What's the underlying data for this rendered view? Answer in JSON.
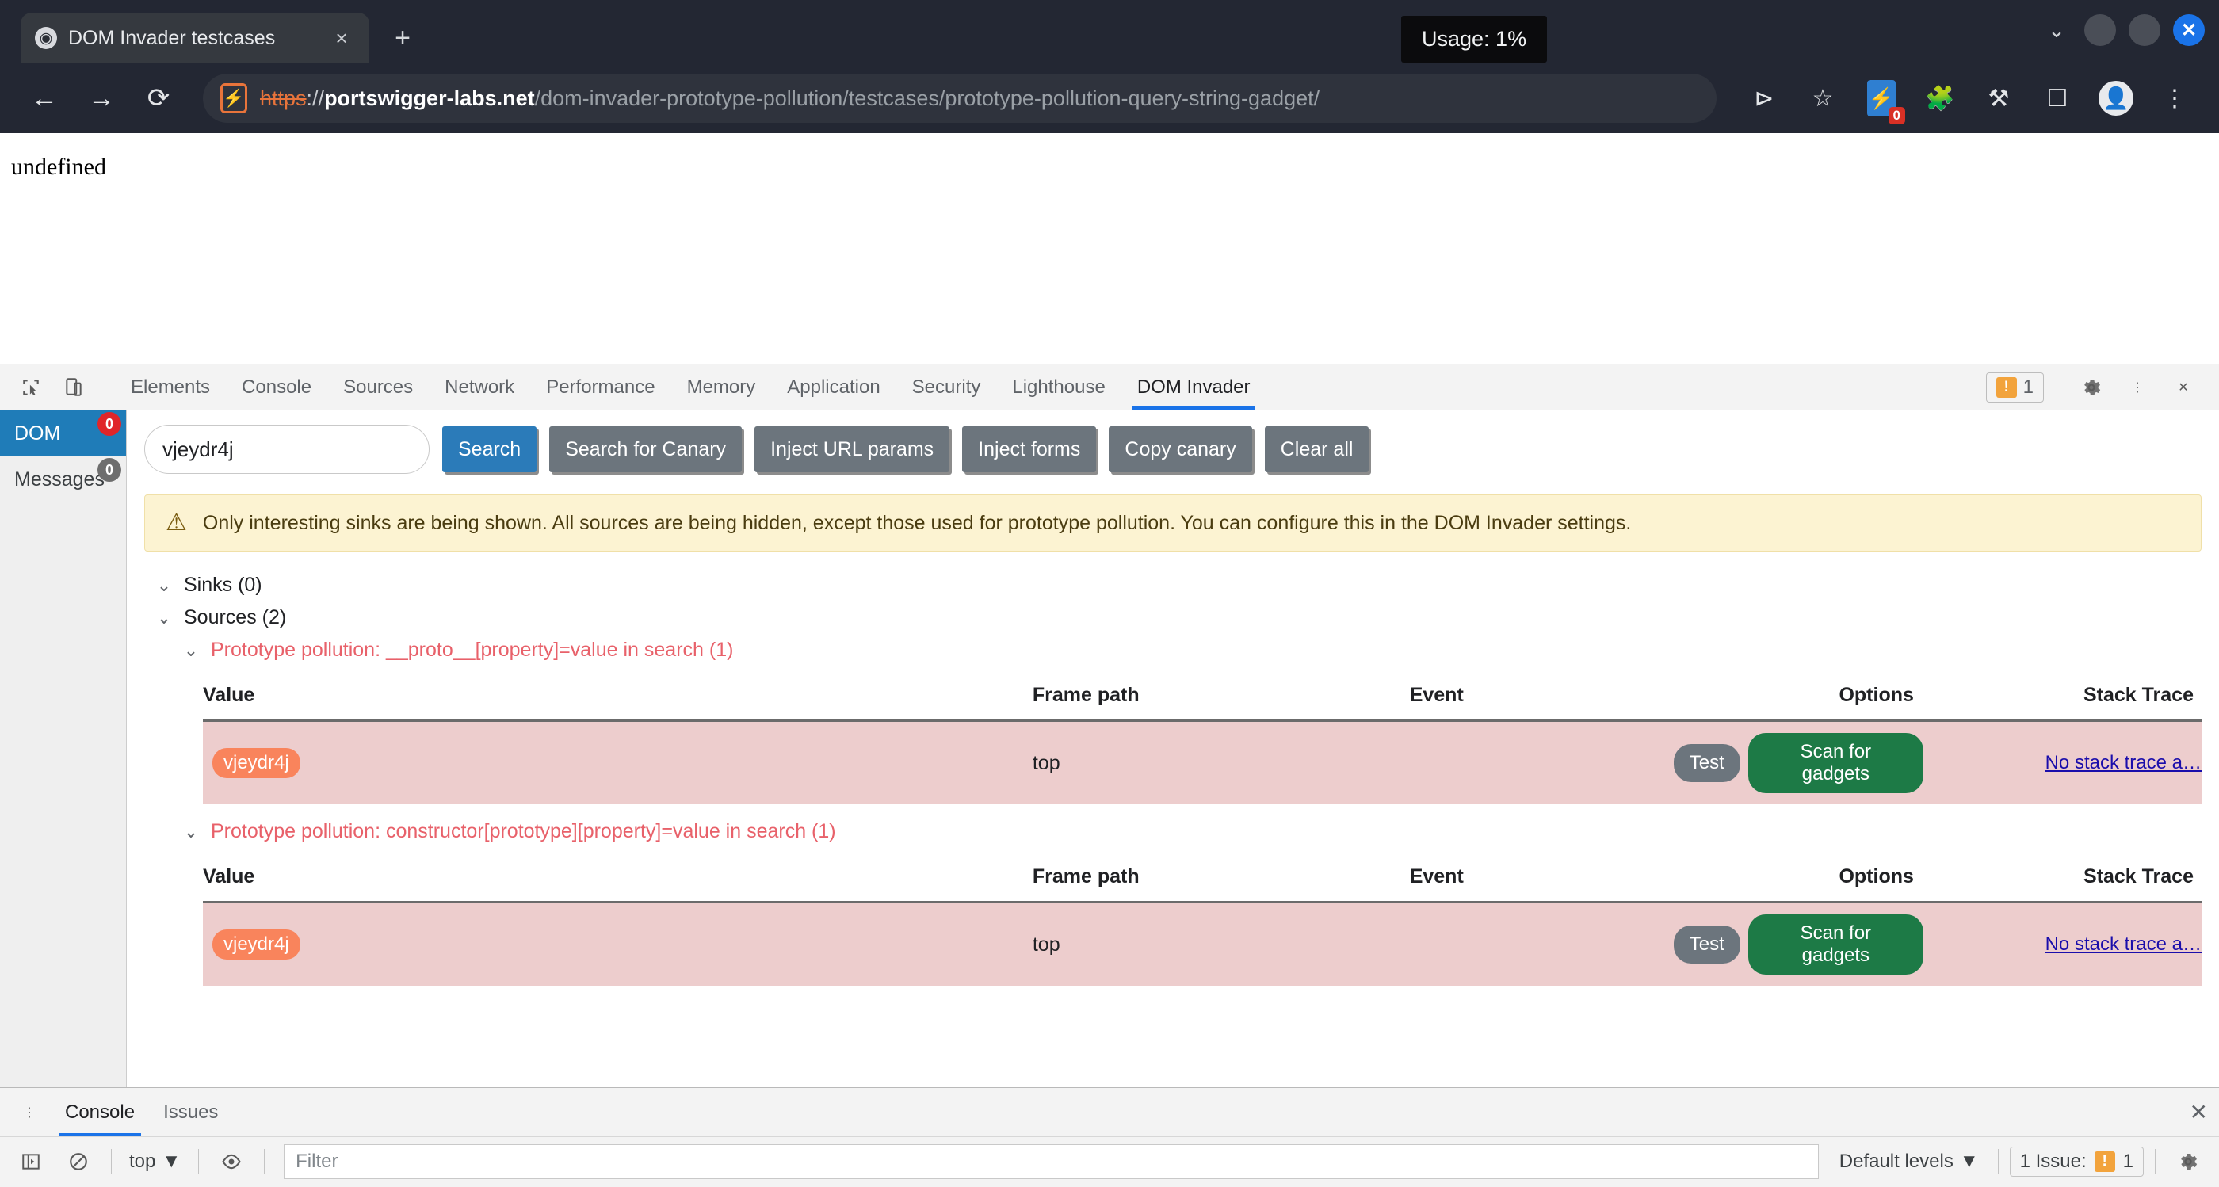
{
  "browser": {
    "tab": {
      "title": "DOM Invader testcases",
      "favicon": "globe-icon",
      "close": "×"
    },
    "newtab_label": "+",
    "window_controls": {
      "chevron": "⌄",
      "minimize": "",
      "maximize": "",
      "close": "✕"
    },
    "tooltip": "Usage: 1%",
    "nav": {
      "back": "←",
      "forward": "→",
      "reload": "⟳"
    },
    "url": {
      "scheme": "https",
      "separator": "://",
      "host": "portswigger-labs.net",
      "path": "/dom-invader-prototype-pollution/testcases/prototype-pollution-query-string-gadget/",
      "security_icon": "not-secure-icon"
    },
    "toolbar_icons": [
      "share-icon",
      "bookmark-star-icon",
      "burp-extension-icon",
      "extensions-puzzle-icon",
      "flask-icon",
      "sidepanel-icon",
      "profile-avatar-icon",
      "more-menu-icon"
    ],
    "burp_badge": "0"
  },
  "page": {
    "body_text": "undefined"
  },
  "devtools": {
    "left_icons": [
      "inspect-element-icon",
      "device-toolbar-icon"
    ],
    "tabs": [
      {
        "label": "Elements",
        "active": false
      },
      {
        "label": "Console",
        "active": false
      },
      {
        "label": "Sources",
        "active": false
      },
      {
        "label": "Network",
        "active": false
      },
      {
        "label": "Performance",
        "active": false
      },
      {
        "label": "Memory",
        "active": false
      },
      {
        "label": "Application",
        "active": false
      },
      {
        "label": "Security",
        "active": false
      },
      {
        "label": "Lighthouse",
        "active": false
      },
      {
        "label": "DOM Invader",
        "active": true
      }
    ],
    "warning_badge": {
      "glyph": "!",
      "count": "1"
    },
    "right_icons": [
      "settings-gear-icon",
      "more-options-icon",
      "close-devtools-icon"
    ]
  },
  "dom_invader": {
    "sidebar": [
      {
        "label": "DOM",
        "badge": "0",
        "badge_color": "#e0252a",
        "active": true
      },
      {
        "label": "Messages",
        "badge": "0",
        "badge_color": "#6e6e6e",
        "active": false
      }
    ],
    "search": {
      "value": "vjeydr4j",
      "placeholder": ""
    },
    "buttons": [
      {
        "label": "Search",
        "style": "primary"
      },
      {
        "label": "Search for Canary",
        "style": "secondary"
      },
      {
        "label": "Inject URL params",
        "style": "secondary"
      },
      {
        "label": "Inject forms",
        "style": "secondary"
      },
      {
        "label": "Copy canary",
        "style": "secondary"
      },
      {
        "label": "Clear all",
        "style": "secondary"
      }
    ],
    "banner": {
      "icon": "warning-triangle-icon",
      "text": "Only interesting sinks are being shown. All sources are being hidden, except those used for prototype pollution. You can configure this in the DOM Invader settings."
    },
    "tree": {
      "sinks_label": "Sinks (0)",
      "sources_label": "Sources (2)",
      "caret": "⌄"
    },
    "columns": [
      "Value",
      "Frame path",
      "Event",
      "Options",
      "Stack Trace"
    ],
    "sources": [
      {
        "title": "Prototype pollution: __proto__[property]=value in search (1)",
        "rows": [
          {
            "value": "vjeydr4j",
            "frame_path": "top",
            "event": "",
            "test_label": "Test",
            "scan_label": "Scan for gadgets",
            "stack_trace": "No stack trace a…"
          }
        ]
      },
      {
        "title": "Prototype pollution: constructor[prototype][property]=value in search (1)",
        "rows": [
          {
            "value": "vjeydr4j",
            "frame_path": "top",
            "event": "",
            "test_label": "Test",
            "scan_label": "Scan for gadgets",
            "stack_trace": "No stack trace a…"
          }
        ]
      }
    ]
  },
  "drawer": {
    "menu_icon": "more-options-icon",
    "tabs": [
      {
        "label": "Console",
        "active": true
      },
      {
        "label": "Issues",
        "active": false
      }
    ],
    "close": "✕",
    "toolbar_icons": [
      "console-sidebar-icon",
      "clear-console-icon",
      "eye-live-expression-icon"
    ],
    "context": {
      "label": "top",
      "caret": "▼"
    },
    "filter_placeholder": "Filter",
    "levels": {
      "label": "Default levels",
      "caret": "▼"
    },
    "issues": {
      "label": "1 Issue:",
      "glyph": "!",
      "count": "1"
    },
    "settings_icon": "settings-gear-icon"
  }
}
